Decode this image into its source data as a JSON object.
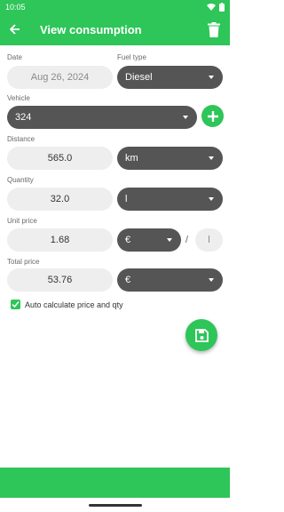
{
  "status": {
    "time": "10:05"
  },
  "app_bar": {
    "title": "View consumption"
  },
  "date": {
    "label": "Date",
    "value": "Aug 26, 2024"
  },
  "fuel_type": {
    "label": "Fuel type",
    "value": "Diesel"
  },
  "vehicle": {
    "label": "Vehicle",
    "value": "324"
  },
  "distance": {
    "label": "Distance",
    "value": "565.0",
    "unit": "km"
  },
  "quantity": {
    "label": "Quantity",
    "value": "32.0",
    "unit": "l"
  },
  "unit_price": {
    "label": "Unit price",
    "value": "1.68",
    "currency": "€",
    "separator": "/",
    "per_unit": "l"
  },
  "total_price": {
    "label": "Total price",
    "value": "53.76",
    "currency": "€"
  },
  "auto_calc": {
    "label": "Auto calculate price and qty",
    "checked": true
  },
  "colors": {
    "accent": "#2ec559",
    "dropdown": "#555555",
    "field": "#eeeeee"
  },
  "icons": {
    "back": "arrow-left-icon",
    "delete": "trash-icon",
    "add": "plus-icon",
    "save": "floppy-disk-icon"
  }
}
